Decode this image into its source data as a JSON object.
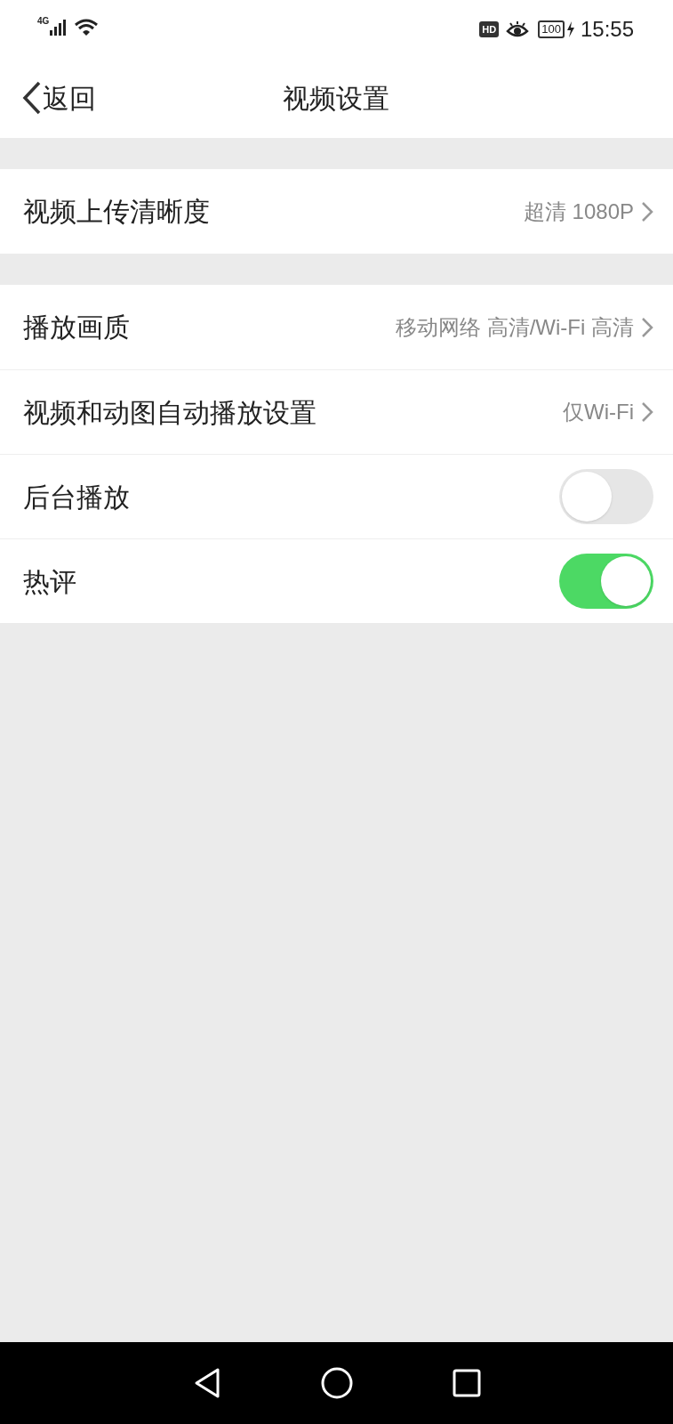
{
  "status_bar": {
    "network": "4G",
    "hd_badge": "HD",
    "battery": "100",
    "time": "15:55"
  },
  "nav_bar": {
    "back": "返回",
    "title": "视频设置"
  },
  "sections": [
    {
      "rows": [
        {
          "kind": "link",
          "label": "视频上传清晰度",
          "value": "超清 1080P"
        }
      ]
    },
    {
      "rows": [
        {
          "kind": "link",
          "label": "播放画质",
          "value": "移动网络 高清/Wi-Fi 高清"
        },
        {
          "kind": "link",
          "label": "视频和动图自动播放设置",
          "value": "仅Wi-Fi"
        },
        {
          "kind": "toggle",
          "label": "后台播放",
          "on": false
        },
        {
          "kind": "toggle",
          "label": "热评",
          "on": true
        }
      ]
    }
  ]
}
